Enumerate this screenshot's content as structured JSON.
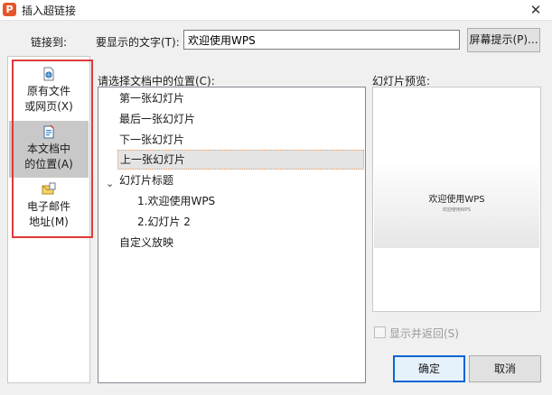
{
  "window": {
    "title": "插入超链接",
    "app_icon": "P",
    "close_glyph": "✕"
  },
  "link_to_label": "链接到:",
  "display_text": {
    "label": "要显示的文字(T):",
    "value": "欢迎使用WPS"
  },
  "screentip_button": "屏幕提示(P)...",
  "nav": [
    {
      "line1": "原有文件",
      "line2": "或网页(X)",
      "icon": "file-web-icon",
      "selected": false
    },
    {
      "line1": "本文档中",
      "line2": "的位置(A)",
      "icon": "document-place-icon",
      "selected": true
    },
    {
      "line1": "电子邮件",
      "line2": "地址(M)",
      "icon": "email-icon",
      "selected": false
    }
  ],
  "location_label": "请选择文档中的位置(C):",
  "tree": {
    "first_slide": "第一张幻灯片",
    "last_slide": "最后一张幻灯片",
    "next_slide": "下一张幻灯片",
    "prev_slide": "上一张幻灯片",
    "slide_titles": "幻灯片标题",
    "slide1": "1.欢迎使用WPS",
    "slide2": "2.幻灯片 2",
    "custom_show": "自定义放映",
    "expand_glyph": "⌄"
  },
  "preview": {
    "label": "幻灯片预览:",
    "slide_title": "欢迎使用WPS",
    "slide_subtitle": "欢迎使用WPS"
  },
  "show_and_return": {
    "label": "显示并返回(S)",
    "checked": false,
    "enabled": false
  },
  "buttons": {
    "ok": "确定",
    "cancel": "取消"
  },
  "colors": {
    "selection_bg": "#c8c8c8",
    "highlight_box": "#e03a3a",
    "default_button_border": "#0a64d3"
  }
}
